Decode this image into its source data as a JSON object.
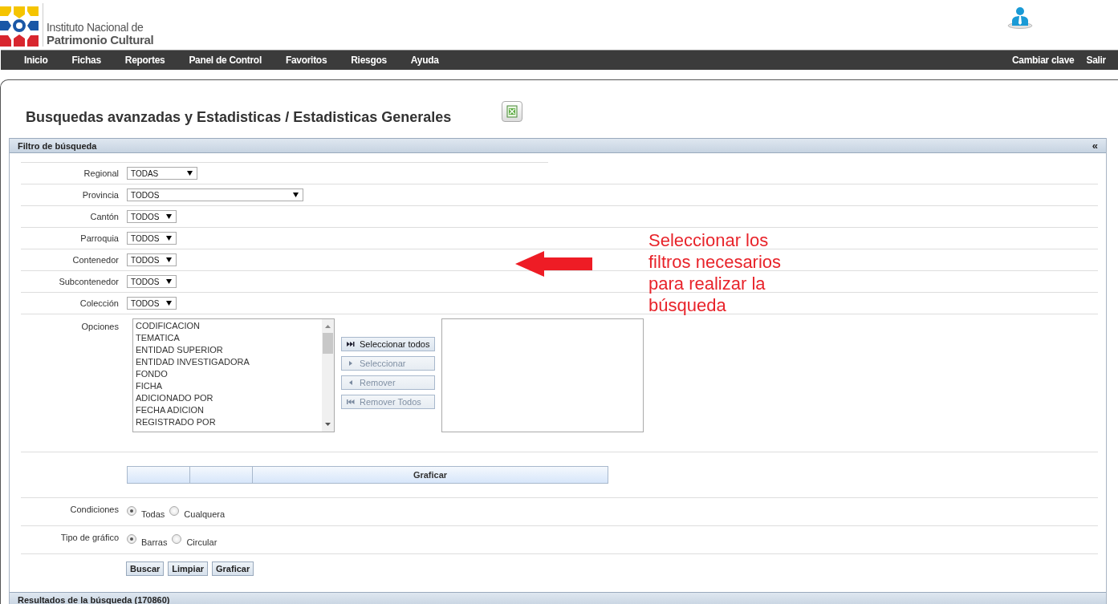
{
  "header": {
    "logo_line1": "Instituto Nacional de",
    "logo_line2": "Patrimonio Cultural"
  },
  "nav": {
    "items": [
      "Inicio",
      "Fichas",
      "Reportes",
      "Panel de Control",
      "Favoritos",
      "Riesgos",
      "Ayuda"
    ],
    "right_items": [
      "Cambiar clave",
      "Salir"
    ]
  },
  "page_title": "Busquedas avanzadas y Estadisticas / Estadisticas Generales",
  "filter_panel": {
    "title": "Filtro de búsqueda",
    "collapse_glyph": "«",
    "fields": [
      {
        "label": "Regional",
        "value": "TODAS"
      },
      {
        "label": "Provincia",
        "value": "TODOS"
      },
      {
        "label": "Cantón",
        "value": "TODOS"
      },
      {
        "label": "Parroquia",
        "value": "TODOS"
      },
      {
        "label": "Contenedor",
        "value": "TODOS"
      },
      {
        "label": "Subcontenedor",
        "value": "TODOS"
      },
      {
        "label": "Colección",
        "value": "TODOS"
      }
    ],
    "options": {
      "label": "Opciones",
      "available": [
        "CODIFICACION",
        "TEMATICA",
        "ENTIDAD SUPERIOR",
        "ENTIDAD INVESTIGADORA",
        "FONDO",
        "FICHA",
        "ADICIONADO POR",
        "FECHA ADICION",
        "REGISTRADO POR"
      ],
      "buttons": [
        {
          "label": "Seleccionar todos",
          "disabled": false
        },
        {
          "label": "Seleccionar",
          "disabled": true
        },
        {
          "label": "Remover",
          "disabled": true
        },
        {
          "label": "Remover Todos",
          "disabled": true
        }
      ]
    },
    "chart_table": {
      "header": "Graficar"
    },
    "radio_groups": [
      {
        "label": "Condiciones",
        "options": [
          {
            "label": "Todas",
            "selected": true
          },
          {
            "label": "Cualquera",
            "selected": false
          }
        ]
      },
      {
        "label": "Tipo de gráfico",
        "options": [
          {
            "label": "Barras",
            "selected": true
          },
          {
            "label": "Circular",
            "selected": false
          }
        ]
      }
    ],
    "action_buttons": [
      "Buscar",
      "Limpiar",
      "Graficar"
    ],
    "annotation": "Seleccionar los filtros necesarios para realizar la búsqueda"
  },
  "results_panel": {
    "title": "Resultados de la búsqueda (170860)"
  }
}
